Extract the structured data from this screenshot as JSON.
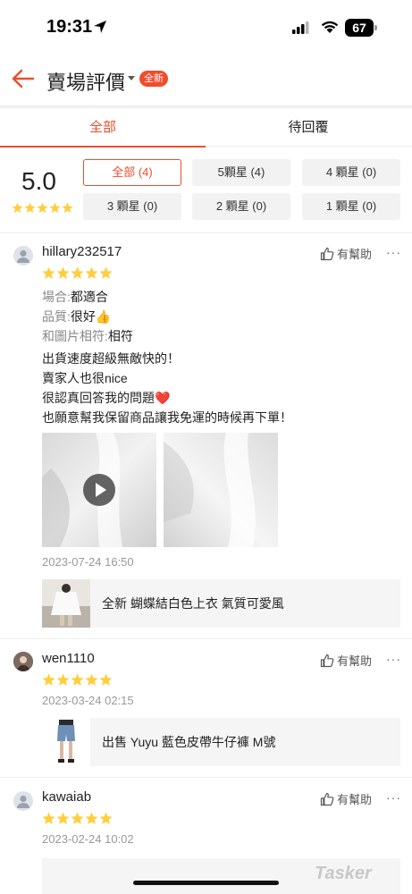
{
  "status_bar": {
    "time": "19:31",
    "battery": "67"
  },
  "header": {
    "title": "賣場評價",
    "badge": "全新"
  },
  "tabs": [
    {
      "label": "全部"
    },
    {
      "label": "待回覆"
    }
  ],
  "summary": {
    "average": "5.0",
    "filters": [
      {
        "label": "全部 (4)"
      },
      {
        "label": "5顆星 (4)"
      },
      {
        "label": "4 顆星 (0)"
      },
      {
        "label": "3 顆星 (0)"
      },
      {
        "label": "2 顆星 (0)"
      },
      {
        "label": "1 顆星 (0)"
      }
    ]
  },
  "reviews": [
    {
      "user": "hillary232517",
      "helpful": "有幫助",
      "attrs": [
        {
          "key": "場合:",
          "value": "都適合"
        },
        {
          "key": "品質:",
          "value": "很好👍"
        },
        {
          "key": "和圖片相符:",
          "value": "相符"
        }
      ],
      "text": [
        "出貨速度超級無敵快的！",
        "賣家人也很nice",
        "很認真回答我的問題❤️",
        "也願意幫我保留商品讓我免運的時候再下單！"
      ],
      "date": "2023-07-24 16:50",
      "product": "全新 蝴蝶結白色上衣 氣質可愛風"
    },
    {
      "user": "wen1110",
      "helpful": "有幫助",
      "date": "2023-03-24 02:15",
      "product": "出售 Yuyu 藍色皮帶牛仔褲 M號"
    },
    {
      "user": "kawaiab",
      "helpful": "有幫助",
      "date": "2023-02-24 10:02"
    }
  ],
  "watermark": "Tasker",
  "colors": {
    "accent": "#ee4d2d",
    "star": "#ffce3d"
  }
}
